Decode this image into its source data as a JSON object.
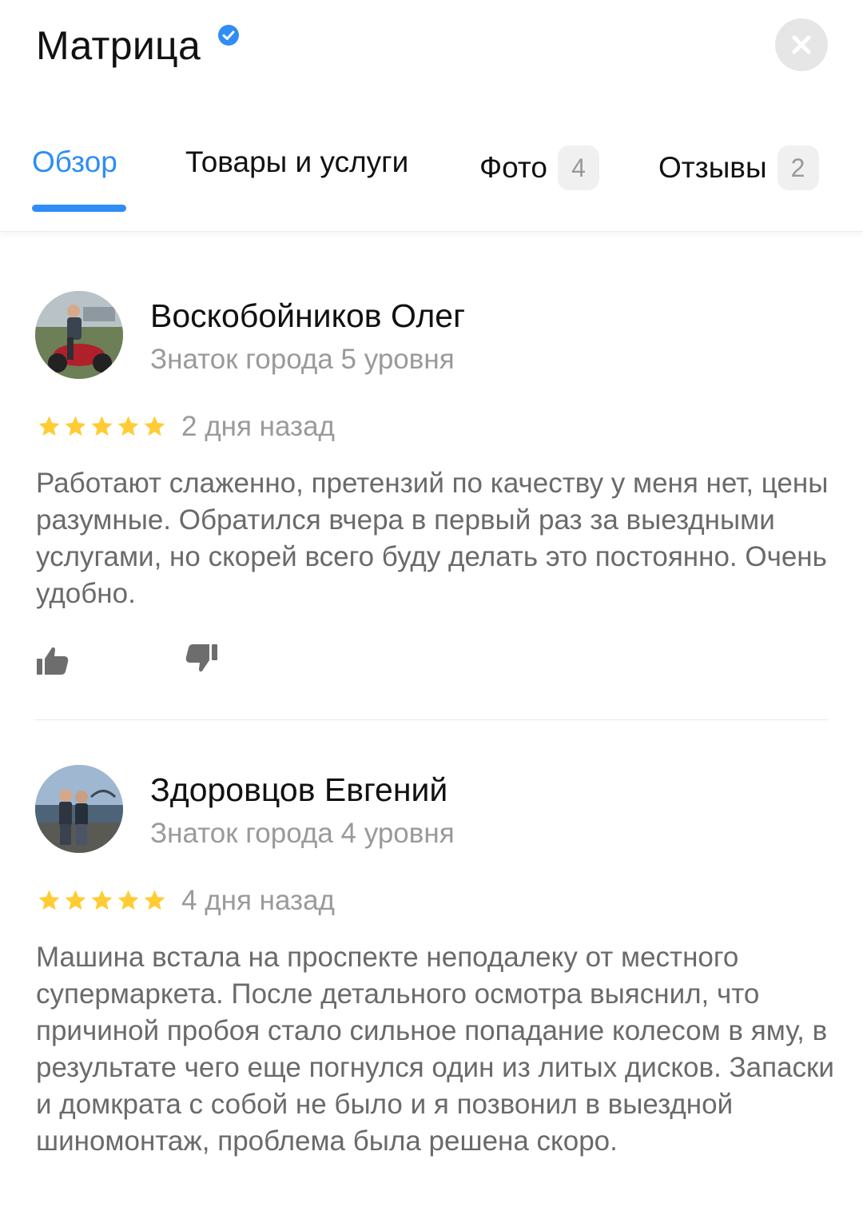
{
  "header": {
    "title": "Матрица"
  },
  "tabs": [
    {
      "label": "Обзор",
      "active": true
    },
    {
      "label": "Товары и услуги"
    },
    {
      "label": "Фото",
      "count": "4"
    },
    {
      "label": "Отзывы",
      "count": "2"
    }
  ],
  "reviews": [
    {
      "author": "Воскобойников Олег",
      "level": "Знаток города 5 уровня",
      "rating": 5,
      "date": "2 дня назад",
      "text": "Работают слаженно, претензий по качеству у меня нет, цены разумные. Обратился вчера в первый раз за выездными услугами, но скорей всего буду делать это постоянно. Очень удобно."
    },
    {
      "author": "Здоровцов Евгений",
      "level": "Знаток города 4 уровня",
      "rating": 5,
      "date": "4 дня назад",
      "text": "Машина встала на проспекте неподалеку от местного супермаркета. После детального осмотра выяснил, что причиной пробоя стало сильное попадание колесом в яму, в результате чего еще погнулся один из литых дисков. Запаски и домкрата с собой не было и я позвонил в выездной шиномонтаж, проблема была решена скоро."
    }
  ],
  "colors": {
    "accent": "#2f8df5",
    "star": "#ffcc33",
    "muted_text": "#9a9a9a",
    "body_text": "#6a6a6a"
  }
}
